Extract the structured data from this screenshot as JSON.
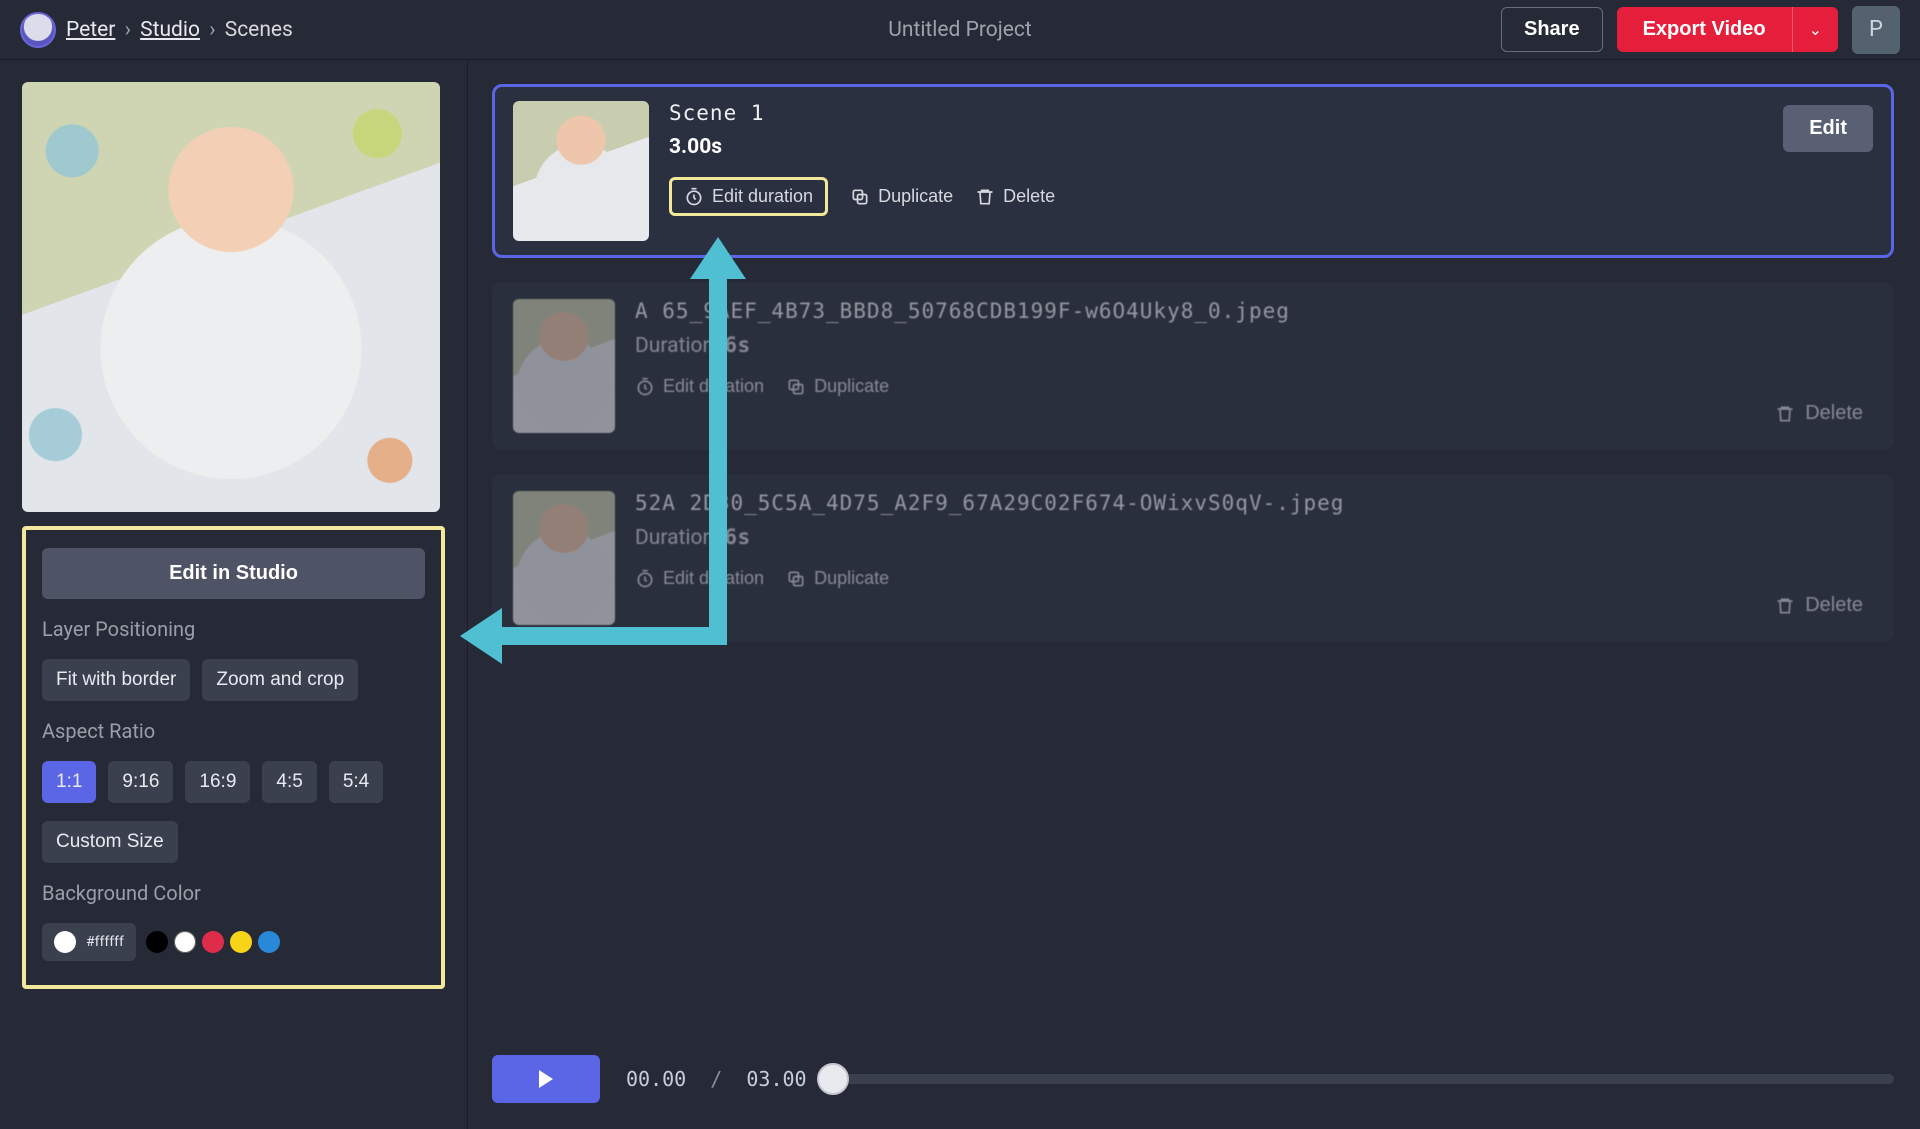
{
  "breadcrumb": {
    "user": "Peter",
    "studio": "Studio",
    "current": "Scenes"
  },
  "project_title": "Untitled Project",
  "buttons": {
    "share": "Share",
    "export": "Export Video",
    "edit_in_studio": "Edit in Studio",
    "edit": "Edit",
    "edit_duration": "Edit duration",
    "duplicate": "Duplicate",
    "delete": "Delete"
  },
  "avatar_initial": "P",
  "left_panel": {
    "layer_positioning_label": "Layer Positioning",
    "positioning_options": [
      "Fit with border",
      "Zoom and crop"
    ],
    "aspect_ratio_label": "Aspect Ratio",
    "aspect_ratios": [
      "1:1",
      "9:16",
      "16:9",
      "4:5",
      "5:4"
    ],
    "aspect_ratio_active": "1:1",
    "custom_size": "Custom Size",
    "background_color_label": "Background Color",
    "color_hex": "#ffffff",
    "swatches": [
      "#000000",
      "#ffffff",
      "#e02c4b",
      "#f7d417",
      "#2a88d8"
    ]
  },
  "scenes": [
    {
      "title": "Scene 1",
      "duration": "3.00s",
      "active": true,
      "edit_duration_highlighted": true
    },
    {
      "title": "A    65_9AEF_4B73_BBD8_50768CDB199F-w6O4Uky8_0.jpeg",
      "duration_label": "Duration: ",
      "duration": "6s",
      "active": false
    },
    {
      "title": "52A 2D30_5C5A_4D75_A2F9_67A29C02F674-OWixvS0qV-.jpeg",
      "duration_label": "Duration: ",
      "duration": "6s",
      "active": false
    }
  ],
  "playback": {
    "current": "00.00",
    "total": "03.00"
  },
  "colors": {
    "accent": "#5a66e6",
    "export": "#e51f3b",
    "highlight": "#f2e79a",
    "arrow": "#4fbfd1"
  }
}
